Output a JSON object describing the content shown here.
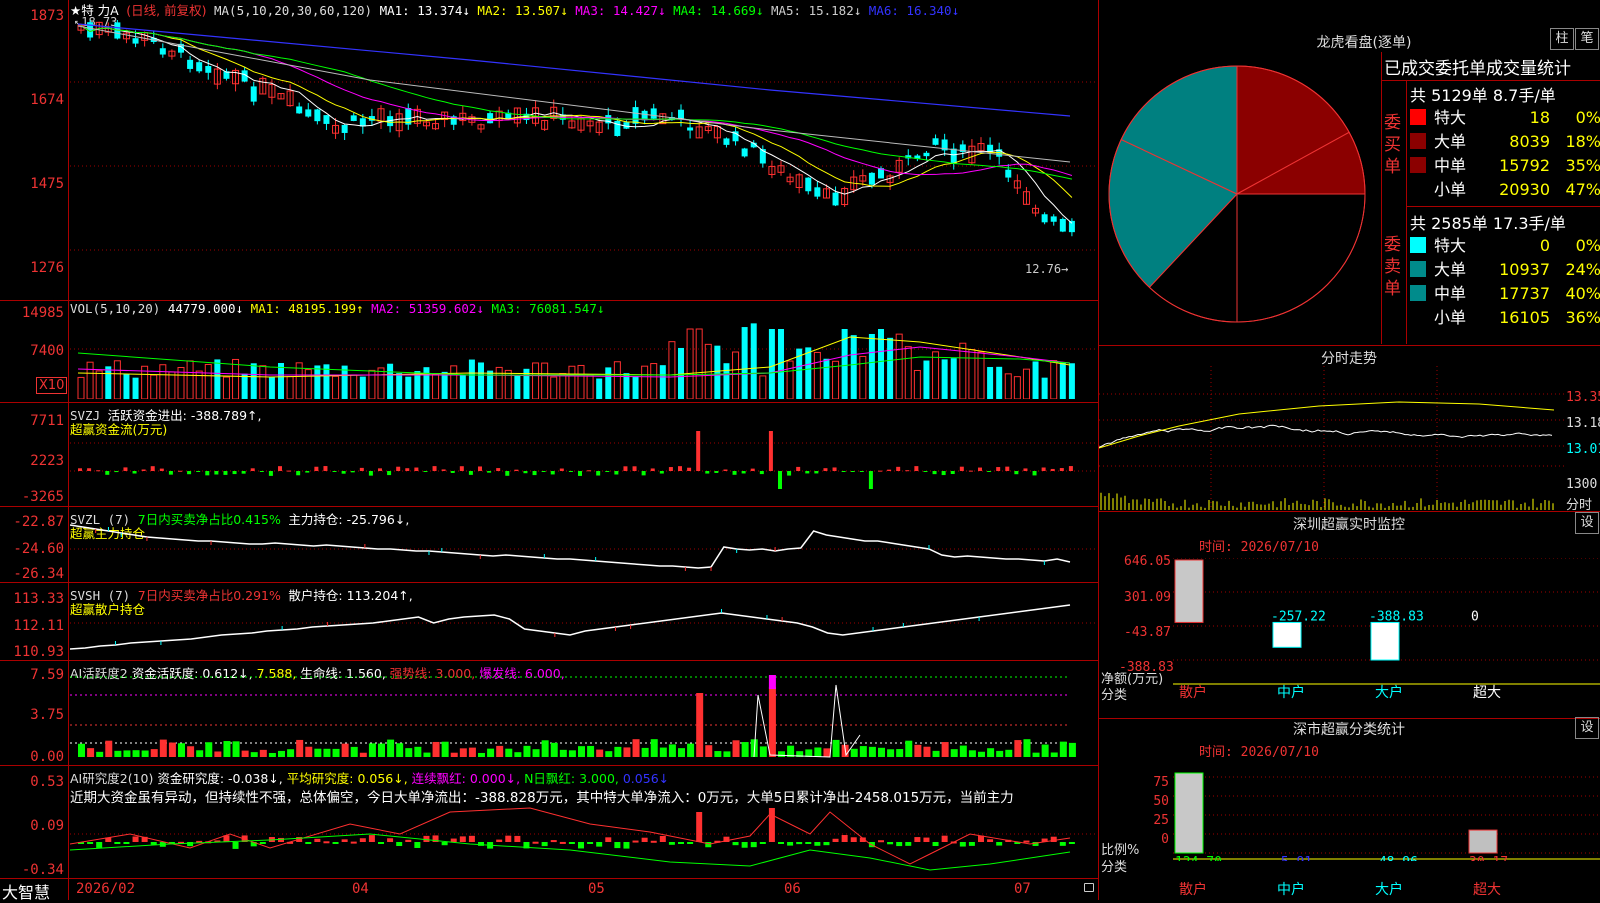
{
  "main": {
    "stock_title": "★特 力A",
    "period": "(日线, 前复权)",
    "ma_label": "MA(5,10,20,30,60,120)",
    "ma1": "MA1: 13.374↓",
    "ma2": "MA2: 13.507↓",
    "ma3": "MA3: 14.427↓",
    "ma4": "MA4: 14.669↓",
    "ma5": "MA5: 15.182↓",
    "ma6": "MA6: 16.340↓",
    "high_mark": "18.73",
    "low_mark": "12.76",
    "axis": [
      "1873",
      "1674",
      "1475",
      "1276"
    ]
  },
  "vol": {
    "label": "VOL(5,10,20)",
    "value": "44779.000↓",
    "ma1": "MA1: 48195.199↑",
    "ma2": "MA2: 51359.602↓",
    "ma3": "MA3: 76081.547↓",
    "axis": [
      "14985",
      "7400"
    ],
    "unit": "X10"
  },
  "svzj": {
    "label": "SVZJ",
    "title": "活跃资金进出: -388.789↑,",
    "subtitle": "超赢资金流(万元)",
    "axis": [
      "7711",
      "2223",
      "-3265"
    ]
  },
  "svzl": {
    "label": "SVZL (7)",
    "title": "7日内买卖净占比0.415%",
    "value": "主力持仓: -25.796↓,",
    "subtitle": "超赢主力持仓",
    "axis": [
      "-22.87",
      "-24.60",
      "-26.34"
    ]
  },
  "svsh": {
    "label": "SVSH (7)",
    "title": "7日内买卖净占比0.291%",
    "value": "散户持仓: 113.204↑,",
    "subtitle": "超赢散户持仓",
    "axis": [
      "113.33",
      "112.11",
      "110.93"
    ]
  },
  "ai1": {
    "label": "AI活跃度2",
    "v1": "资金活跃度: 0.612↓,",
    "v2": "7.588,",
    "v3": "生命线: 1.560,",
    "v4": "强势线: 3.000,",
    "v5": "爆发线: 6.000,",
    "axis": [
      "7.59",
      "3.75",
      "0.00"
    ]
  },
  "ai2": {
    "label": "AI研究度2(10)",
    "v1": "资金研究度: -0.038↓,",
    "v2": "平均研究度: 0.056↓,",
    "v3": "连续飘红: 0.000↓,",
    "v4": "N日飘红: 3.000,",
    "v5": "0.056↓",
    "comment": "近期大资金虽有异动，但持续性不强，总体偏空，今日大单净流出：-388.828万元，其中特大单净流入：0万元，大单5日累计净出-2458.015万元，当前主力",
    "axis": [
      "0.53",
      "0.09",
      "-0.34"
    ]
  },
  "xaxis": {
    "logo": "大智慧",
    "labels": [
      "2026/02",
      "04",
      "05",
      "06",
      "07"
    ]
  },
  "lhb": {
    "title": "龙虎看盘(逐单)",
    "btn1": "柱",
    "btn2": "笔",
    "table_title": "已成交委托单成交量统计",
    "buy_side": "委买单",
    "sell_side": "委卖单",
    "buy_total": "共 5129单 8.7手/单",
    "sell_total": "共 2585单 17.3手/单",
    "buy_rows": [
      {
        "name": "特大",
        "vol": "18",
        "pct": "0%",
        "color": "#ff0000"
      },
      {
        "name": "大单",
        "vol": "8039",
        "pct": "18%",
        "color": "#8b0000"
      },
      {
        "name": "中单",
        "vol": "15792",
        "pct": "35%",
        "color": "#8b0000"
      },
      {
        "name": "小单",
        "vol": "20930",
        "pct": "47%",
        "color": "#000000"
      }
    ],
    "sell_rows": [
      {
        "name": "特大",
        "vol": "0",
        "pct": "0%",
        "color": "#00ffff"
      },
      {
        "name": "大单",
        "vol": "10937",
        "pct": "24%",
        "color": "#008b8b"
      },
      {
        "name": "中单",
        "vol": "17737",
        "pct": "40%",
        "color": "#008b8b"
      },
      {
        "name": "小单",
        "vol": "16105",
        "pct": "36%",
        "color": "#000000"
      }
    ]
  },
  "intraday": {
    "title": "分时走势",
    "axis": [
      "13.35",
      "13.18",
      "13.01"
    ],
    "vol_axis": "1300",
    "unit": "分时"
  },
  "monitor": {
    "title": "深圳超赢实时监控",
    "btn": "设",
    "time": "时间: 2026/07/10",
    "axis": [
      "646.05",
      "301.09",
      "-43.87",
      "-388.83"
    ],
    "unit": "净额(万元)",
    "cat_label": "分类",
    "values": [
      "646.05",
      "-257.22",
      "-388.83",
      "0"
    ],
    "cats": [
      "散户",
      "中户",
      "大户",
      "超大"
    ]
  },
  "classify": {
    "title": "深市超赢分类统计",
    "btn": "设",
    "time": "时间: 2026/07/10",
    "axis": [
      "75",
      "50",
      "25",
      "0"
    ],
    "unit": "比例%",
    "cat_label": "分类",
    "values": [
      "124.70",
      "-5.91",
      "-48.96",
      "30.17"
    ],
    "cats": [
      "散户",
      "中户",
      "大户",
      "超大"
    ]
  },
  "colors": {
    "up": "#ff3030",
    "down": "#00ffff",
    "green": "#00ff00",
    "grid": "#a00000",
    "axis_text": "#ff3333"
  }
}
